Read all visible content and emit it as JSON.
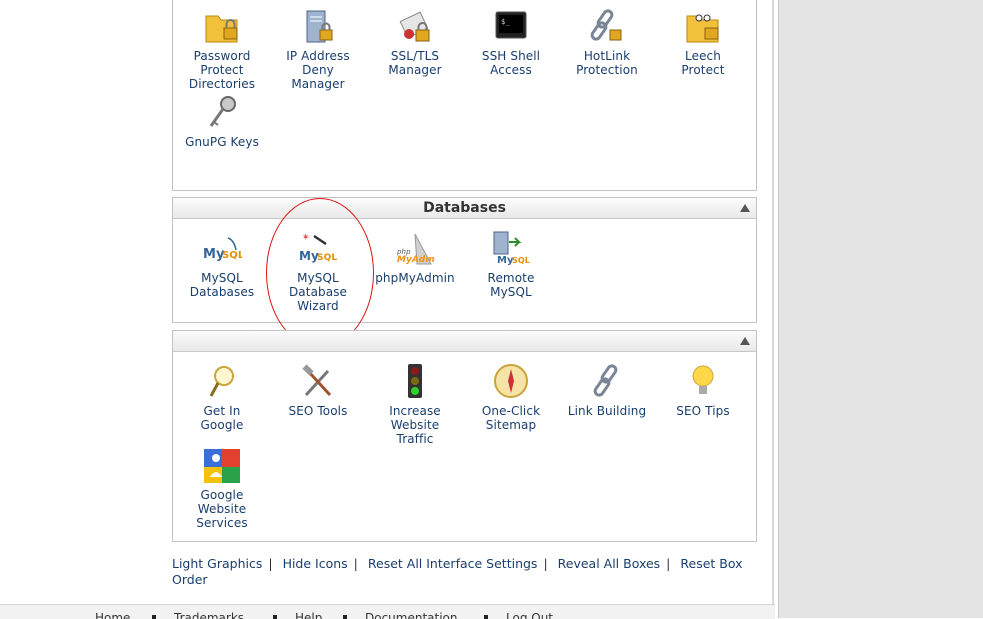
{
  "security": {
    "items": [
      {
        "label": "Password\nProtect\nDirectories",
        "icon": "folder-lock-icon"
      },
      {
        "label": "IP Address\nDeny\nManager",
        "icon": "server-lock-icon"
      },
      {
        "label": "SSL/TLS\nManager",
        "icon": "certificate-lock-icon"
      },
      {
        "label": "SSH Shell\nAccess",
        "icon": "terminal-icon"
      },
      {
        "label": "HotLink\nProtection",
        "icon": "chain-lock-icon"
      },
      {
        "label": "Leech\nProtect",
        "icon": "folder-lock-icon"
      },
      {
        "label": "GnuPG Keys",
        "icon": "keys-icon"
      }
    ]
  },
  "databases": {
    "title": "Databases",
    "items": [
      {
        "label": "MySQL\nDatabases",
        "icon": "mysql-icon"
      },
      {
        "label": "MySQL\nDatabase\nWizard",
        "icon": "mysql-wizard-icon"
      },
      {
        "label": "phpMyAdmin",
        "icon": "phpmyadmin-icon"
      },
      {
        "label": "Remote\nMySQL",
        "icon": "remote-mysql-icon"
      }
    ]
  },
  "seo": {
    "title": "",
    "items": [
      {
        "label": "Get In\nGoogle",
        "icon": "magnifier-icon"
      },
      {
        "label": "SEO Tools",
        "icon": "tools-icon"
      },
      {
        "label": "Increase\nWebsite\nTraffic",
        "icon": "traffic-light-icon"
      },
      {
        "label": "One-Click\nSitemap",
        "icon": "compass-icon"
      },
      {
        "label": "Link Building",
        "icon": "chain-icon"
      },
      {
        "label": "SEO Tips",
        "icon": "lightbulb-icon"
      },
      {
        "label": "Google\nWebsite\nServices",
        "icon": "google-icon"
      }
    ]
  },
  "footer_links": [
    "Light Graphics",
    "Hide Icons",
    "Reset All Interface Settings",
    "Reveal All Boxes",
    "Reset Box Order"
  ],
  "footer_separator": "|",
  "bottom_nav": [
    "Home",
    "Trademarks",
    "Help",
    "Documentation",
    "Log Out"
  ]
}
